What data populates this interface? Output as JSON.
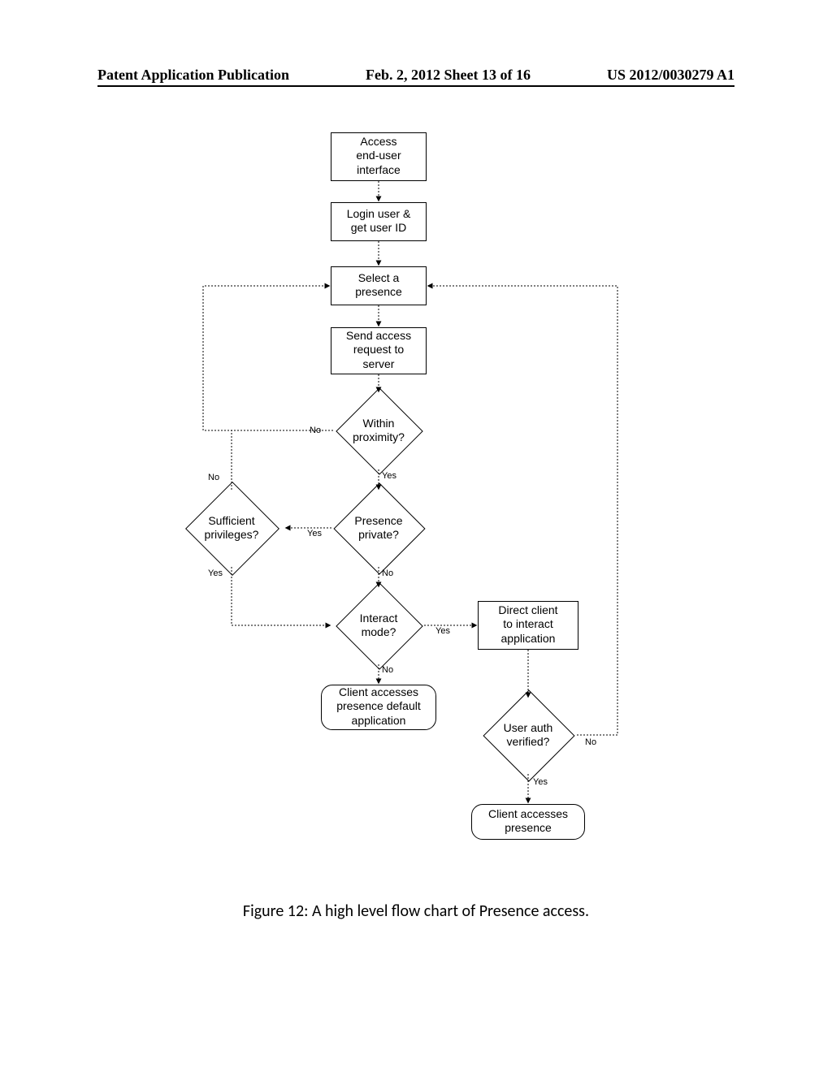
{
  "header": {
    "left": "Patent Application Publication",
    "center": "Feb. 2, 2012  Sheet 13 of 16",
    "right": "US 2012/0030279 A1"
  },
  "nodes": {
    "n1": "Access\nend-user\ninterface",
    "n2": "Login user &\nget user ID",
    "n3": "Select a\npresence",
    "n4": "Send access\nrequest to\nserver",
    "d1": "Within\nproximity?",
    "d2": "Presence\nprivate?",
    "d2b": "Sufficient\nprivileges?",
    "d3": "Interact\nmode?",
    "n5": "Client accesses\npresence default\napplication",
    "n6": "Direct client\nto interact\napplication",
    "d4": "User auth\nverified?",
    "n7": "Client accesses\npresence"
  },
  "labels": {
    "no": "No",
    "yes": "Yes"
  },
  "caption": "Figure 12: A high level flow chart of Presence access."
}
